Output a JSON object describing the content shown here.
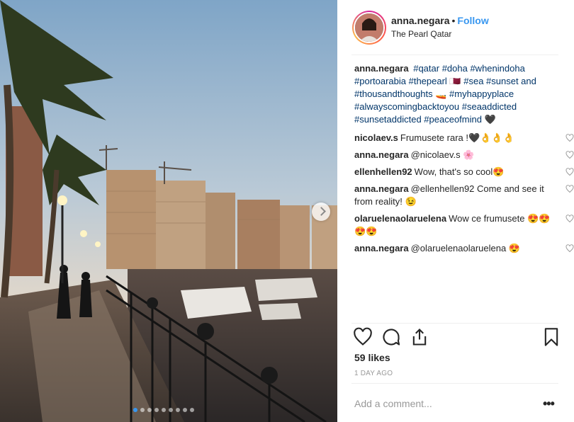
{
  "post": {
    "username": "anna.negara",
    "separator": "•",
    "follow_label": "Follow",
    "location": "The Pearl Qatar"
  },
  "caption": {
    "author": "anna.negara",
    "text": "#qatar #doha #whenindoha #portoarabia #thepearl 🇶🇦 #sea #sunset and #thousandthoughts 🚤 #myhappyplace #alwayscomingbacktoyou #seaaddicted #sunsetaddicted #peaceofmind 🖤"
  },
  "comments": [
    {
      "author": "nicolaev.s",
      "text": "Frumusete rara !🖤👌👌👌"
    },
    {
      "author": "anna.negara",
      "text": "@nicolaev.s 🌸"
    },
    {
      "author": "ellenhellen92",
      "text": "Wow, that's so cool😍"
    },
    {
      "author": "anna.negara",
      "text": "@ellenhellen92 Come and see it from reality! 😉"
    },
    {
      "author": "olaruelenaolaruelena",
      "text": "Wow ce frumusete 😍😍😍😍"
    },
    {
      "author": "anna.negara",
      "text": "@olaruelenaolaruelena 😍"
    }
  ],
  "likes_text": "59 likes",
  "time_text": "1 DAY AGO",
  "add_comment_placeholder": "Add a comment...",
  "more_label": "•••",
  "carousel": {
    "count": 9,
    "active": 0
  },
  "icons": {
    "like": "heart-outline-icon",
    "comment": "comment-bubble-icon",
    "share": "share-icon",
    "save": "bookmark-icon",
    "next": "chevron-right-icon"
  },
  "colors": {
    "link": "#3897f0",
    "hashtag": "#003569",
    "muted": "#999999"
  }
}
